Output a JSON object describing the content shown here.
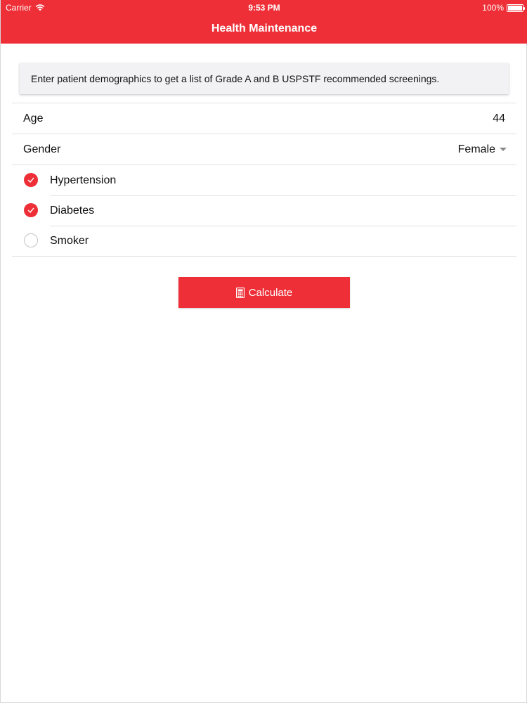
{
  "status_bar": {
    "carrier": "Carrier",
    "time": "9:53 PM",
    "battery": "100%"
  },
  "header": {
    "title": "Health Maintenance",
    "color": "#ee2f37"
  },
  "info": {
    "text": "Enter patient demographics to get a list of Grade A and B USPSTF recommended screenings."
  },
  "form": {
    "age": {
      "label": "Age",
      "value": "44"
    },
    "gender": {
      "label": "Gender",
      "value": "Female"
    },
    "conditions": [
      {
        "label": "Hypertension",
        "checked": true
      },
      {
        "label": "Diabetes",
        "checked": true
      },
      {
        "label": "Smoker",
        "checked": false
      }
    ]
  },
  "actions": {
    "calculate_label": "Calculate",
    "calculate_icon": "calculator-icon"
  }
}
